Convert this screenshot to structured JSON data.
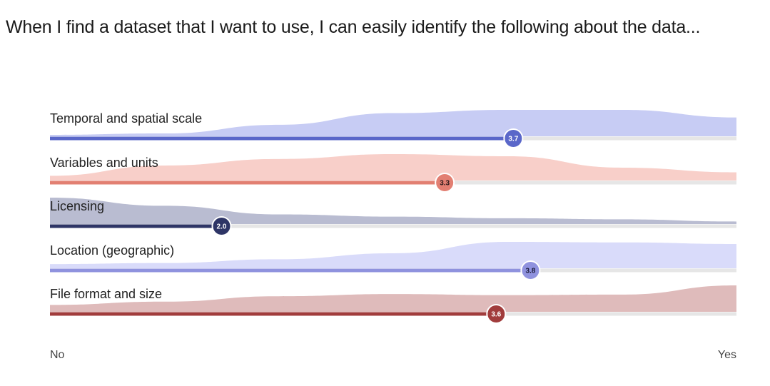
{
  "title": "When I find a dataset that I want to use, I can easily identify the following about the data...",
  "chart_data": {
    "type": "bar",
    "title": "When I find a dataset that I want to use, I can easily identify the following about the data...",
    "x_axis": {
      "min": 1,
      "max": 5,
      "left_label": "No",
      "right_label": "Yes"
    },
    "categories": [
      "Temporal and spatial scale",
      "Variables and units",
      "Licensing",
      "Location (geographic)",
      "File format and size"
    ],
    "values": [
      3.7,
      3.3,
      2.0,
      3.8,
      3.6
    ],
    "value_labels": [
      "3.7",
      "3.3",
      "2.0",
      "3.8",
      "3.6"
    ],
    "distributions": [
      [
        0.08,
        0.13,
        0.45,
        0.88,
        1.0,
        1.0,
        0.72
      ],
      [
        0.2,
        0.58,
        0.82,
        1.0,
        0.92,
        0.5,
        0.33
      ],
      [
        1.0,
        0.7,
        0.38,
        0.3,
        0.24,
        0.2,
        0.12
      ],
      [
        0.18,
        0.22,
        0.36,
        0.58,
        1.0,
        0.98,
        0.92
      ],
      [
        0.28,
        0.4,
        0.6,
        0.68,
        0.64,
        0.66,
        1.0
      ]
    ],
    "colors": {
      "bars": [
        "#5a67c9",
        "#e27f72",
        "#2e3566",
        "#8f92de",
        "#a13c3c"
      ],
      "areas": [
        "#c7ccf4",
        "#f8cfc9",
        "#b9bcd1",
        "#d9dbfa",
        "#dfbbbb"
      ],
      "track": "#e6e6e6",
      "value_text": [
        "#ffffff",
        "#2b1a1a",
        "#ffffff",
        "#1b1b3a",
        "#ffffff"
      ]
    },
    "grid": false,
    "legend": "none"
  }
}
